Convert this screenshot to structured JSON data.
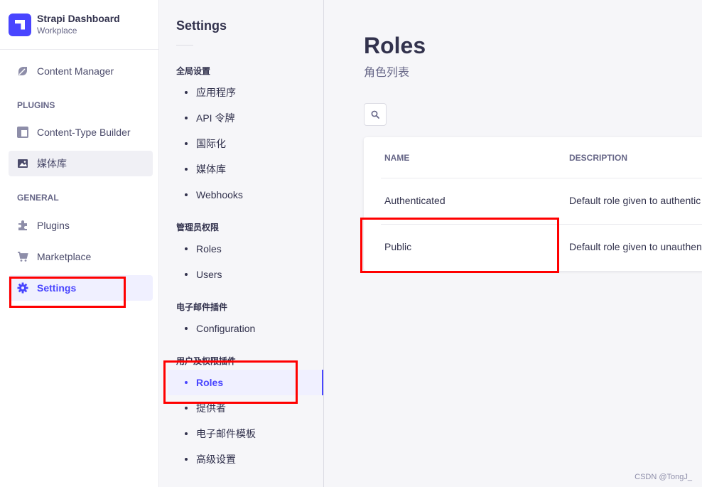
{
  "brand": {
    "title": "Strapi Dashboard",
    "subtitle": "Workplace"
  },
  "mainnav": {
    "content_manager": "Content Manager",
    "plugins_section": "PLUGINS",
    "content_type_builder": "Content-Type Builder",
    "media_library": "媒体库",
    "general_section": "GENERAL",
    "plugins": "Plugins",
    "marketplace": "Marketplace",
    "settings": "Settings"
  },
  "subnav": {
    "title": "Settings",
    "sections": [
      {
        "label": "全局设置",
        "items": [
          "应用程序",
          "API 令牌",
          "国际化",
          "媒体库",
          "Webhooks"
        ]
      },
      {
        "label": "管理员权限",
        "items": [
          "Roles",
          "Users"
        ]
      },
      {
        "label": "电子邮件插件",
        "items": [
          "Configuration"
        ]
      },
      {
        "label": "用户及权限插件",
        "items": [
          "Roles",
          "提供者",
          "电子邮件模板",
          "高级设置"
        ]
      }
    ]
  },
  "page": {
    "title": "Roles",
    "subtitle": "角色列表",
    "table": {
      "headers": [
        "NAME",
        "DESCRIPTION"
      ],
      "rows": [
        {
          "name": "Authenticated",
          "description": "Default role given to authentic"
        },
        {
          "name": "Public",
          "description": "Default role given to unauthen"
        }
      ]
    }
  },
  "accent_color": "#4945ff",
  "watermark": "CSDN @TongJ_"
}
